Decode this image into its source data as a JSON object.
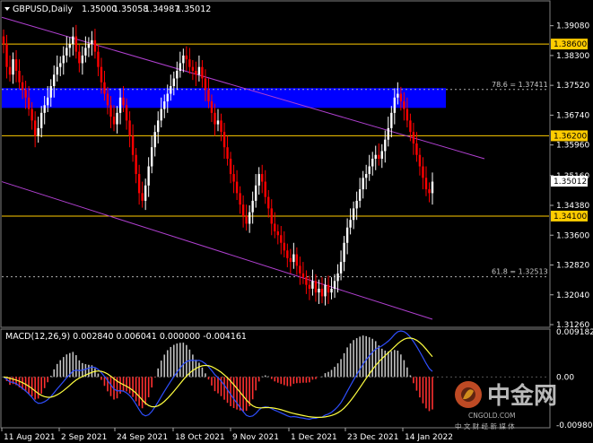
{
  "chart_data": {
    "type": "candlestick",
    "symbol": "GBPUSD,Daily",
    "ohlc": {
      "open": "1.35000",
      "high": "1.35058",
      "low": "1.34987",
      "close": "1.35012"
    },
    "price_axis_ticks": [
      "1.39080",
      "1.38300",
      "1.37520",
      "1.36740",
      "1.35960",
      "1.35160",
      "1.34380",
      "1.33600",
      "1.32820",
      "1.32040",
      "1.31260"
    ],
    "price_range": [
      1.3126,
      1.3933
    ],
    "date_labels": [
      "11 Aug 2021",
      "2 Sep 2021",
      "24 Sep 2021",
      "18 Oct 2021",
      "9 Nov 2021",
      "1 Dec 2021",
      "23 Dec 2021",
      "14 Jan 2022"
    ],
    "horizontal_levels": [
      {
        "value": 1.386,
        "label": "1.38600",
        "color": "#ffcc00"
      },
      {
        "value": 1.362,
        "label": "1.36200",
        "color": "#ffcc00"
      },
      {
        "value": 1.341,
        "label": "1.34100",
        "color": "#ffcc00"
      }
    ],
    "fibo_levels": [
      {
        "value": 1.37411,
        "label": "78.6 = 1.37411"
      },
      {
        "value": 1.32513,
        "label": "61.8 = 1.32513"
      }
    ],
    "current_price_label": "1.35012",
    "supply_zone": {
      "from": 1.3693,
      "to": 1.3745,
      "color": "#0000ff"
    },
    "channel_lines": [
      {
        "from_date": "Aug 2021",
        "from_price": 1.393,
        "to_date": "late Jan 2022",
        "to_price": 1.356
      },
      {
        "from_date": "Aug 2021",
        "from_price": 1.35,
        "to_date": "late Jan 2022",
        "to_price": 1.314
      }
    ],
    "candles_close": [
      1.386,
      1.38,
      1.378,
      1.382,
      1.379,
      1.376,
      1.374,
      1.372,
      1.369,
      1.366,
      1.362,
      1.364,
      1.368,
      1.37,
      1.372,
      1.375,
      1.378,
      1.38,
      1.381,
      1.383,
      1.385,
      1.386,
      1.388,
      1.384,
      1.381,
      1.383,
      1.385,
      1.386,
      1.387,
      1.384,
      1.38,
      1.376,
      1.373,
      1.37,
      1.367,
      1.365,
      1.368,
      1.372,
      1.37,
      1.366,
      1.362,
      1.357,
      1.352,
      1.347,
      1.345,
      1.349,
      1.354,
      1.359,
      1.363,
      1.366,
      1.369,
      1.371,
      1.373,
      1.375,
      1.377,
      1.379,
      1.381,
      1.383,
      1.382,
      1.38,
      1.379,
      1.378,
      1.38,
      1.377,
      1.374,
      1.371,
      1.368,
      1.365,
      1.366,
      1.363,
      1.359,
      1.356,
      1.352,
      1.35,
      1.347,
      1.344,
      1.341,
      1.339,
      1.342,
      1.345,
      1.349,
      1.352,
      1.35,
      1.346,
      1.343,
      1.339,
      1.337,
      1.336,
      1.334,
      1.332,
      1.33,
      1.329,
      1.331,
      1.328,
      1.326,
      1.325,
      1.323,
      1.322,
      1.324,
      1.321,
      1.322,
      1.32,
      1.323,
      1.321,
      1.322,
      1.324,
      1.326,
      1.329,
      1.334,
      1.338,
      1.34,
      1.343,
      1.345,
      1.348,
      1.351,
      1.352,
      1.354,
      1.356,
      1.357,
      1.356,
      1.358,
      1.361,
      1.364,
      1.368,
      1.372,
      1.373,
      1.371,
      1.369,
      1.366,
      1.363,
      1.36,
      1.357,
      1.354,
      1.351,
      1.348,
      1.347,
      1.35
    ],
    "macd": {
      "label": "MACD(12,26,9) 0.002840 0.006041 0.000000 -0.004161",
      "axis_ticks": [
        "0.009182",
        "0.00",
        "-0.009806"
      ],
      "range": [
        -0.0098,
        0.0092
      ]
    }
  },
  "watermark": {
    "brand_cn": "中金网",
    "tagline_cn": "中 文 财 经 新 媒 体",
    "site": "CNGOLD.COM"
  }
}
